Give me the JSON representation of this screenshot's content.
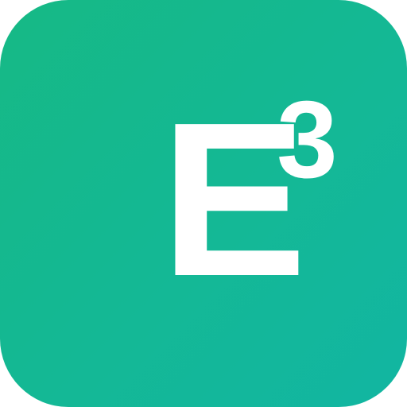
{
  "icon": {
    "letter": "E",
    "exponent": "3",
    "gradient_start": "#16b985",
    "gradient_end": "#12b6a2",
    "glyph_color": "#ffffff"
  }
}
